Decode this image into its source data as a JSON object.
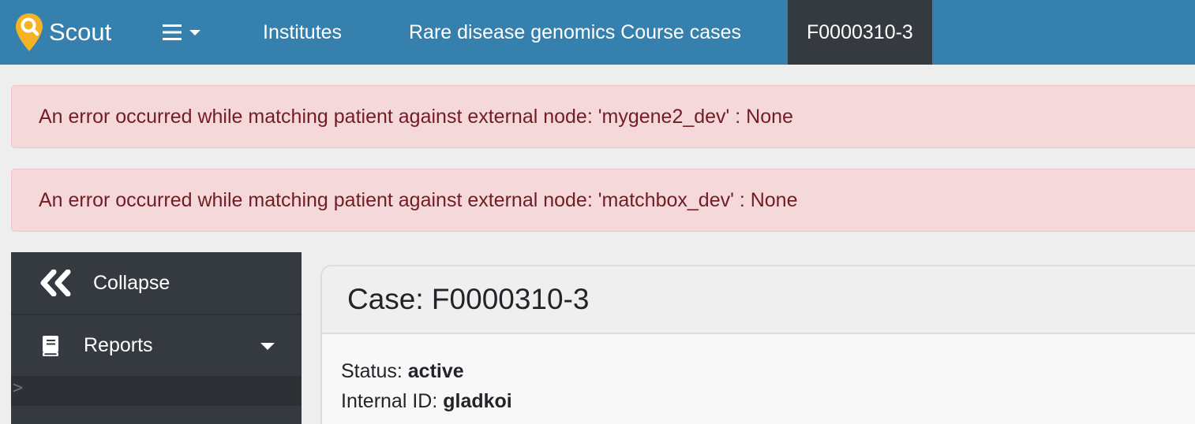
{
  "navbar": {
    "brand": "Scout",
    "links": [
      "Institutes",
      "Rare disease genomics Course cases"
    ],
    "active_case": "F0000310-3",
    "colors": {
      "background": "#3680ae",
      "active": "#343a40",
      "logo": "#f5b324"
    }
  },
  "alerts": [
    "An error occurred while matching patient against external node: 'mygene2_dev' : None",
    "An error occurred while matching patient against external node: 'matchbox_dev' : None"
  ],
  "sidebar": {
    "collapse_label": "Collapse",
    "reports_label": "Reports",
    "submenu_marker": ">",
    "icons": {
      "collapse": "double-chevron-left-icon",
      "reports": "book-icon",
      "reports_toggle": "caret-down-icon"
    }
  },
  "case": {
    "title": "Case: F0000310-3",
    "status_label": "Status:",
    "status_value": "active",
    "internal_id_label": "Internal ID:",
    "internal_id_value": "gladkoi"
  }
}
